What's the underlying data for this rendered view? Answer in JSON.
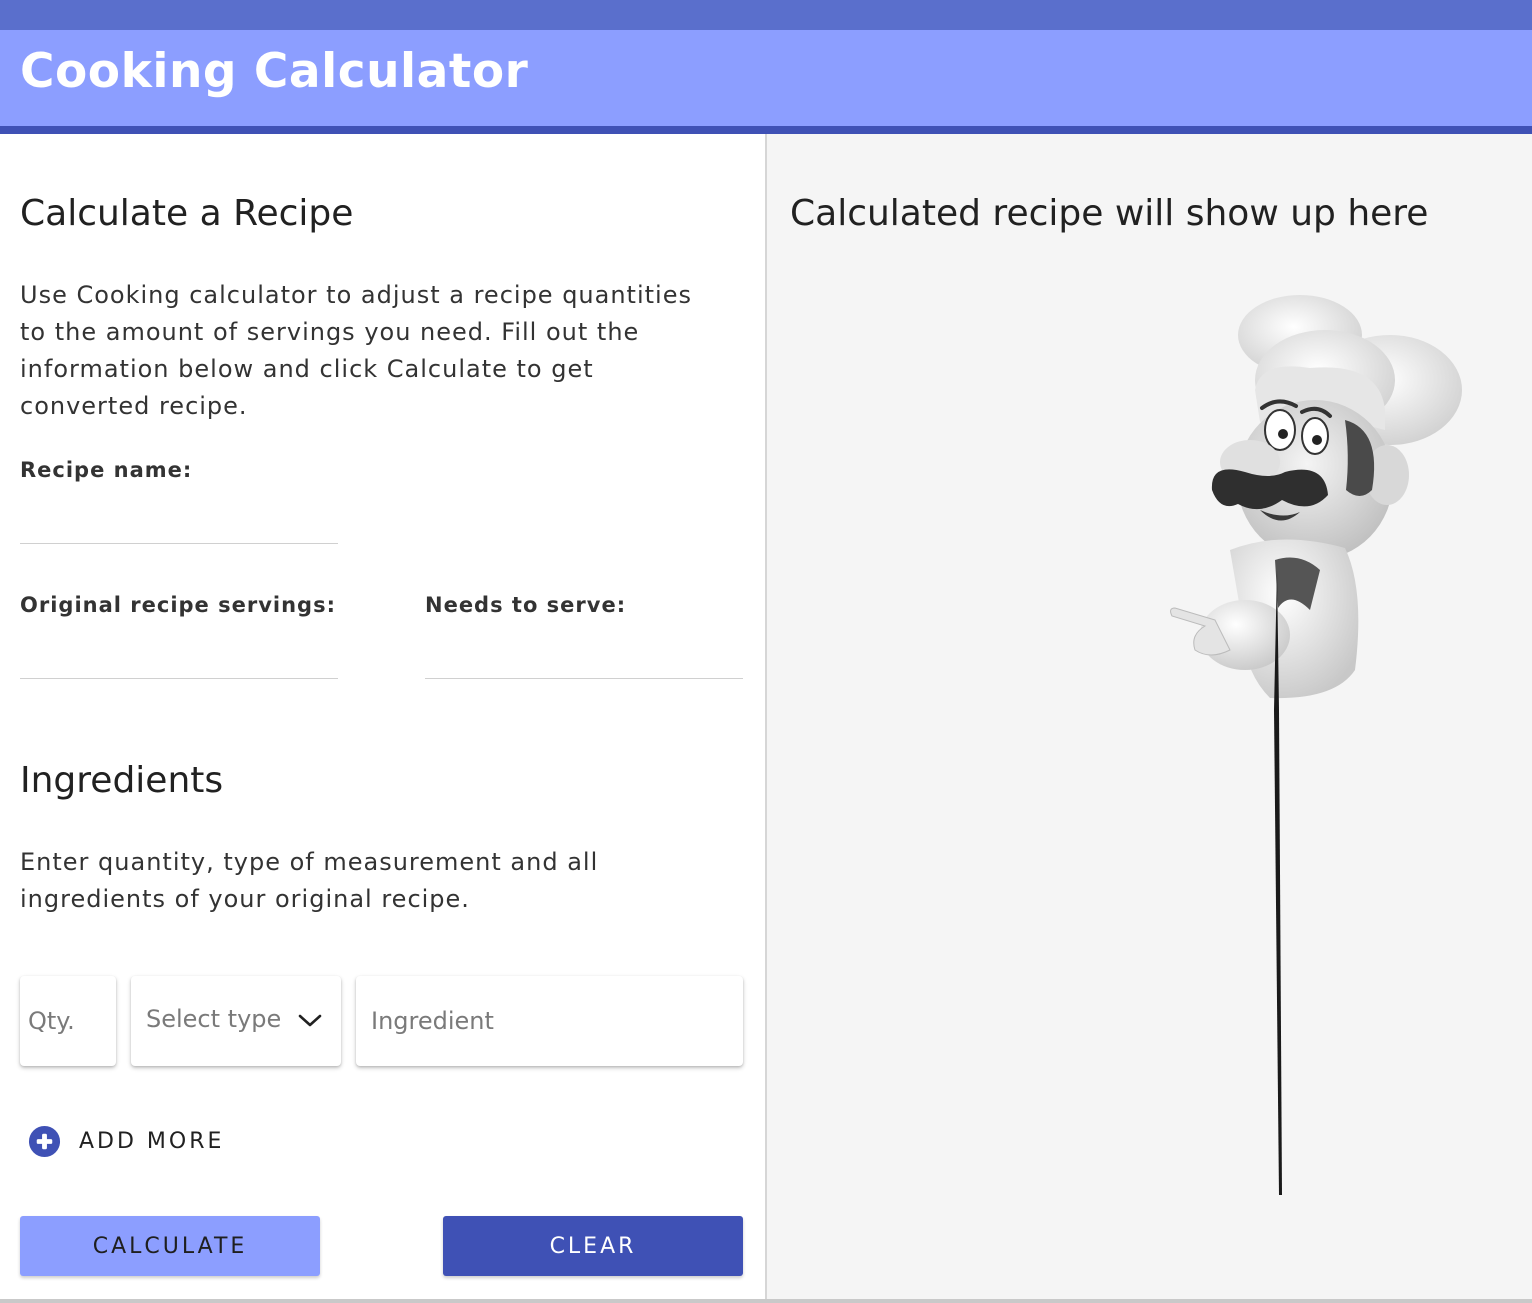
{
  "app": {
    "title": "Cooking Calculator"
  },
  "left": {
    "heading": "Calculate a Recipe",
    "intro_lines": [
      "Use Cooking calculator to adjust a recipe quantities",
      "to the amount of servings you need. Fill out the",
      "information below and click Calculate to get",
      "converted recipe."
    ],
    "recipe_name_label": "Recipe name:",
    "recipe_name_value": "",
    "original_servings_label": "Original recipe servings:",
    "original_servings_value": "",
    "needs_to_serve_label": "Needs to serve:",
    "needs_to_serve_value": "",
    "ingredients_heading": "Ingredients",
    "ingredients_lines": [
      "Enter quantity, type of measurement and all",
      "ingredients of your original recipe."
    ],
    "ingredient_row": {
      "qty_placeholder": "Qty.",
      "type_placeholder": "Select type",
      "ingredient_placeholder": "Ingredient"
    },
    "add_more_label": "ADD MORE",
    "calculate_label": "CALCULATE",
    "clear_label": "CLEAR"
  },
  "right": {
    "heading": "Calculated recipe will show up here"
  },
  "icons": {
    "add": "plus-circle-icon",
    "select": "chevron-down-icon",
    "illustration": "chef-illustration"
  },
  "colors": {
    "topbar": "#5a6fcc",
    "header": "#8c9eff",
    "header_border": "#3f51b5",
    "calculate_button": "#8c9eff",
    "clear_button": "#3f51b5",
    "right_panel": "#f5f5f5"
  }
}
